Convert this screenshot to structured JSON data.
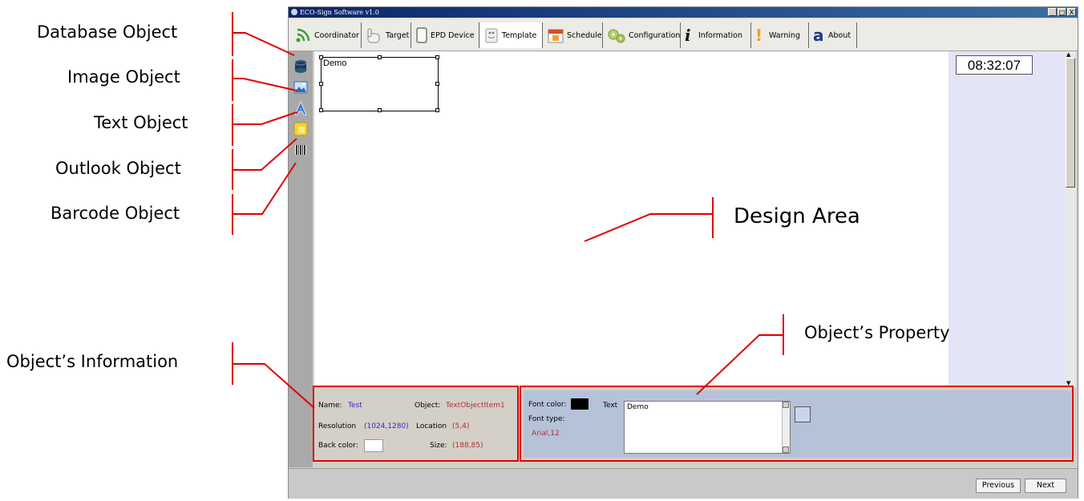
{
  "annotations": {
    "database_object": "Database Object",
    "image_object": "Image Object",
    "text_object": "Text Object",
    "outlook_object": "Outlook Object",
    "barcode_object": "Barcode Object",
    "objects_information": "Object’s Information",
    "design_area": "Design Area",
    "objects_property": "Object’s Property"
  },
  "window": {
    "title": "ECO-Sign Software v1.0",
    "buttons": [
      "_",
      "□",
      "X"
    ]
  },
  "tabs": [
    {
      "label": "Coordinator",
      "icon": "wireless-signal-icon"
    },
    {
      "label": "Target",
      "icon": "hand-pointer-icon"
    },
    {
      "label": "EPD Device",
      "icon": "epd-device-icon"
    },
    {
      "label": "Template",
      "icon": "template-icon",
      "active": true
    },
    {
      "label": "Schedule",
      "icon": "calendar-icon"
    },
    {
      "label": "Configuration",
      "icon": "gears-icon"
    },
    {
      "label": "Information",
      "icon": "info-icon"
    },
    {
      "label": "Warning",
      "icon": "warning-icon"
    },
    {
      "label": "About",
      "icon": "about-icon"
    }
  ],
  "design_area": {
    "demo_text": "Demo",
    "clock": "08:32:07"
  },
  "info_panel": {
    "name_label": "Name:",
    "name_value": "Test",
    "object_label": "Object:",
    "object_value": "TextObjectItem1",
    "resolution_label": "Resolution",
    "resolution_value": "(1024,1280)",
    "location_label": "Location",
    "location_value": "(5,4)",
    "back_color_label": "Back color:",
    "back_color": "#ffffff",
    "size_label": "Size:",
    "size_value": "(188,85)"
  },
  "property_panel": {
    "font_color_label": "Font color:",
    "font_color": "#000000",
    "font_type_label": "Font type:",
    "font_type_value": "Arial,12",
    "text_label": "Text",
    "text_value": "Demo"
  },
  "footer": {
    "previous": "Previous",
    "next": "Next"
  },
  "colors": {
    "annotation_red": "#e00000",
    "title_bar": "#0a246a",
    "property_bg": "#b6c2d8"
  }
}
